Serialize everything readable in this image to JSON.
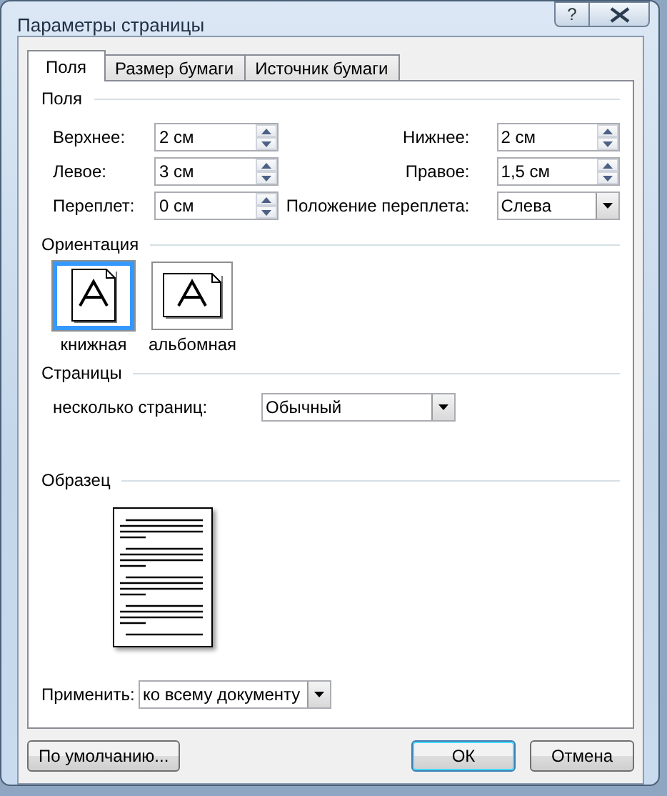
{
  "window": {
    "title": "Параметры страницы",
    "help_button": "?"
  },
  "tabs": [
    {
      "label": "Поля",
      "selected": true
    },
    {
      "label": "Размер бумаги",
      "selected": false
    },
    {
      "label": "Источник бумаги",
      "selected": false
    }
  ],
  "margins": {
    "title": "Поля",
    "rows": [
      {
        "left": {
          "label": "Верхнее:",
          "value": "2 см"
        },
        "right": {
          "kind": "spin",
          "label": "Нижнее:",
          "value": "2 см"
        }
      },
      {
        "left": {
          "label": "Левое:",
          "value": "3 см"
        },
        "right": {
          "kind": "spin",
          "label": "Правое:",
          "value": "1,5 см"
        }
      },
      {
        "left": {
          "label": "Переплет:",
          "value": "0 см"
        },
        "right": {
          "kind": "dropdown",
          "label": "Положение переплета:",
          "value": "Слева"
        }
      }
    ]
  },
  "orientation": {
    "title": "Ориентация",
    "options": [
      {
        "kind": "portrait",
        "label": "книжная",
        "selected": true
      },
      {
        "kind": "landscape",
        "label": "альбомная",
        "selected": false
      }
    ]
  },
  "pages": {
    "title": "Страницы",
    "label": "несколько страниц:",
    "value": "Обычный"
  },
  "preview": {
    "title": "Образец"
  },
  "apply": {
    "label": "Применить:",
    "value": "ко всему документу"
  },
  "buttons": [
    {
      "label": "По умолчанию...",
      "default": false
    },
    {
      "label": "ОК",
      "default": true
    },
    {
      "label": "Отмена",
      "default": false
    }
  ]
}
